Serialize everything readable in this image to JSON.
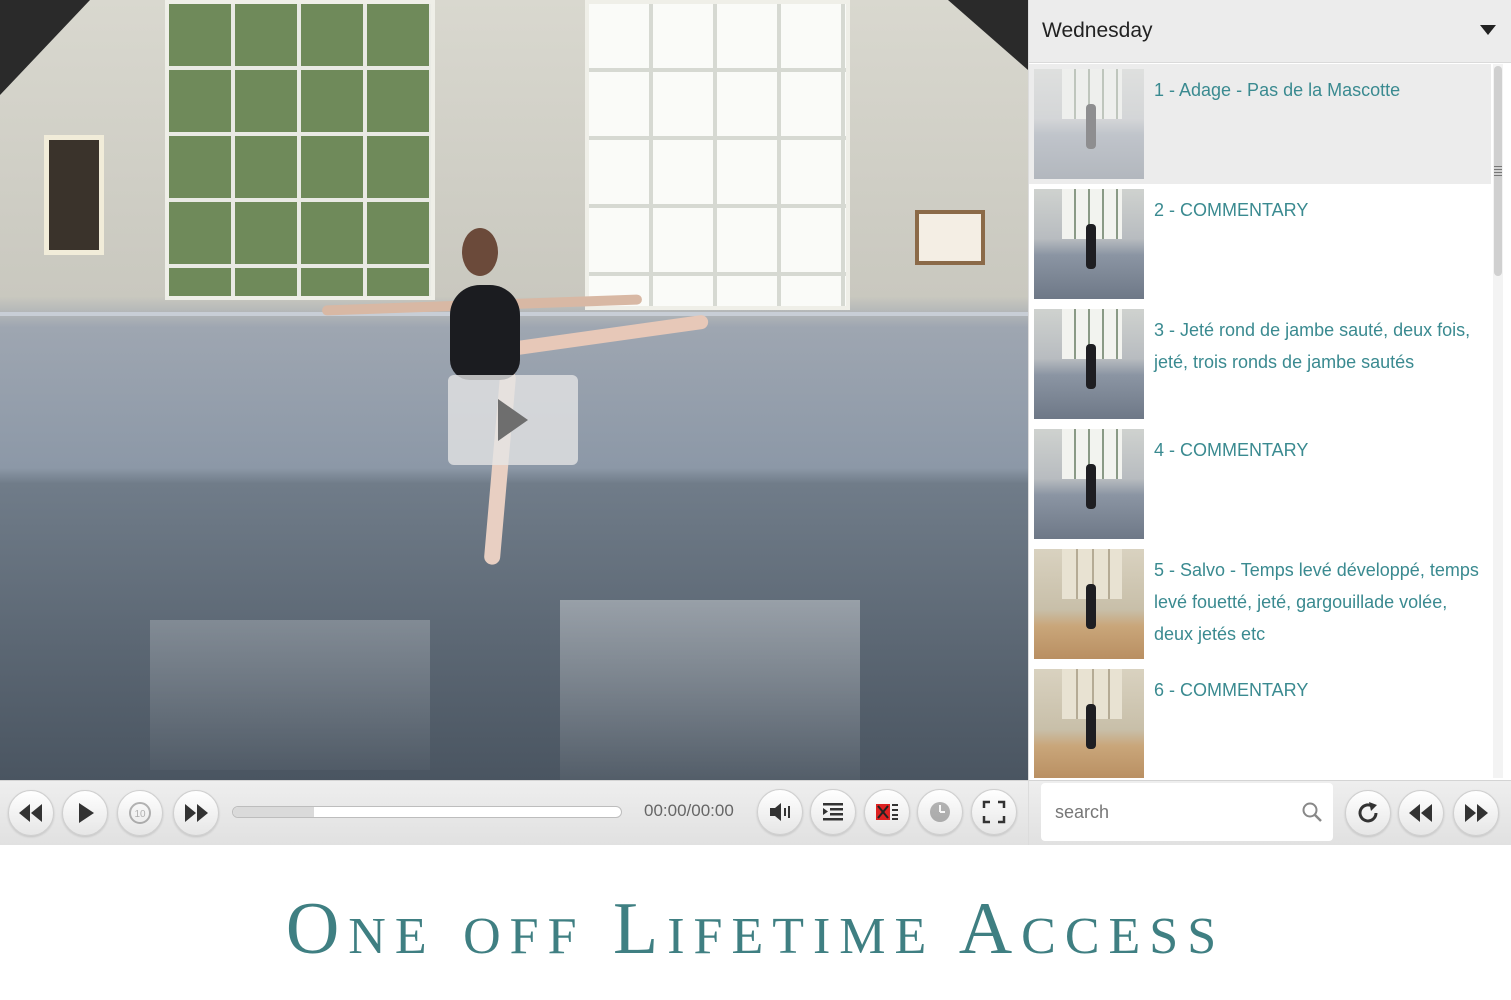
{
  "player": {
    "time": "00:00/00:00",
    "progress_fraction": 0.21,
    "icons": {
      "rewind": "rewind-icon",
      "play": "play-icon",
      "replay10": "replay-10-icon",
      "forward": "fast-forward-icon",
      "volume": "volume-icon",
      "playlist": "playlist-icon",
      "captions": "captions-off-icon",
      "clock": "clock-icon",
      "fullscreen": "fullscreen-icon"
    },
    "replay_label": "10"
  },
  "playlist": {
    "title": "Wednesday",
    "items": [
      {
        "label": "1 - Adage - Pas de la Mascotte",
        "active": true
      },
      {
        "label": "2 - COMMENTARY",
        "active": false
      },
      {
        "label": "3 - Jeté rond de jambe sauté, deux fois, jeté, trois ronds de jambe sautés",
        "active": false
      },
      {
        "label": "4 - COMMENTARY",
        "active": false
      },
      {
        "label": "5 - Salvo - Temps levé développé, temps levé fouetté, jeté, gargouillade volée, deux jetés etc",
        "active": false
      },
      {
        "label": "6 - COMMENTARY",
        "active": false
      }
    ],
    "search": {
      "placeholder": "search"
    }
  },
  "banner": {
    "text": "One off Lifetime Access"
  },
  "colors": {
    "accent": "#3a8a90",
    "banner": "#3f7f82",
    "header_bg": "#ececec"
  }
}
